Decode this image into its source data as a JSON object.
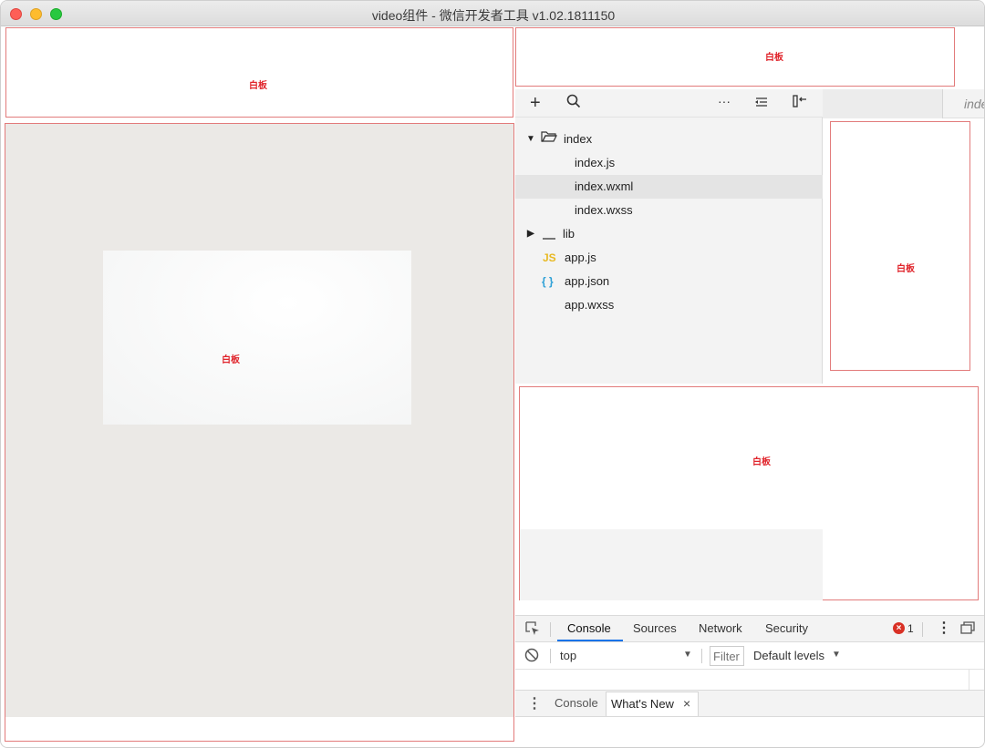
{
  "window": {
    "title": "video组件 - 微信开发者工具 v1.02.1811150"
  },
  "board_label": "白板",
  "file_tree": {
    "items": [
      {
        "label": "index",
        "type": "folder-open"
      },
      {
        "label": "index.js",
        "type": "file"
      },
      {
        "label": "index.wxml",
        "type": "file",
        "selected": true
      },
      {
        "label": "index.wxss",
        "type": "file"
      },
      {
        "label": "lib",
        "type": "folder-closed"
      },
      {
        "label": "app.js",
        "type": "js"
      },
      {
        "label": "app.json",
        "type": "json"
      },
      {
        "label": "app.wxss",
        "type": "file"
      }
    ],
    "js_glyph": "JS",
    "json_glyph": "{ }"
  },
  "editor": {
    "tab_label": "index"
  },
  "devtools": {
    "tabs": [
      "Console",
      "Sources",
      "Network",
      "Security"
    ],
    "active_tab": "Console",
    "error_count": "1",
    "context_select": "top",
    "filter_placeholder": "Filter",
    "levels_select": "Default levels",
    "drawer_tabs": [
      "Console",
      "What's New"
    ],
    "close_glyph": "×"
  },
  "colors": {
    "board_border": "#e27b7b",
    "board_label": "#e0242b",
    "accent": "#1a73e8",
    "error": "#d93025",
    "js_icon": "#e8b923",
    "json_icon": "#2a9fd6"
  }
}
